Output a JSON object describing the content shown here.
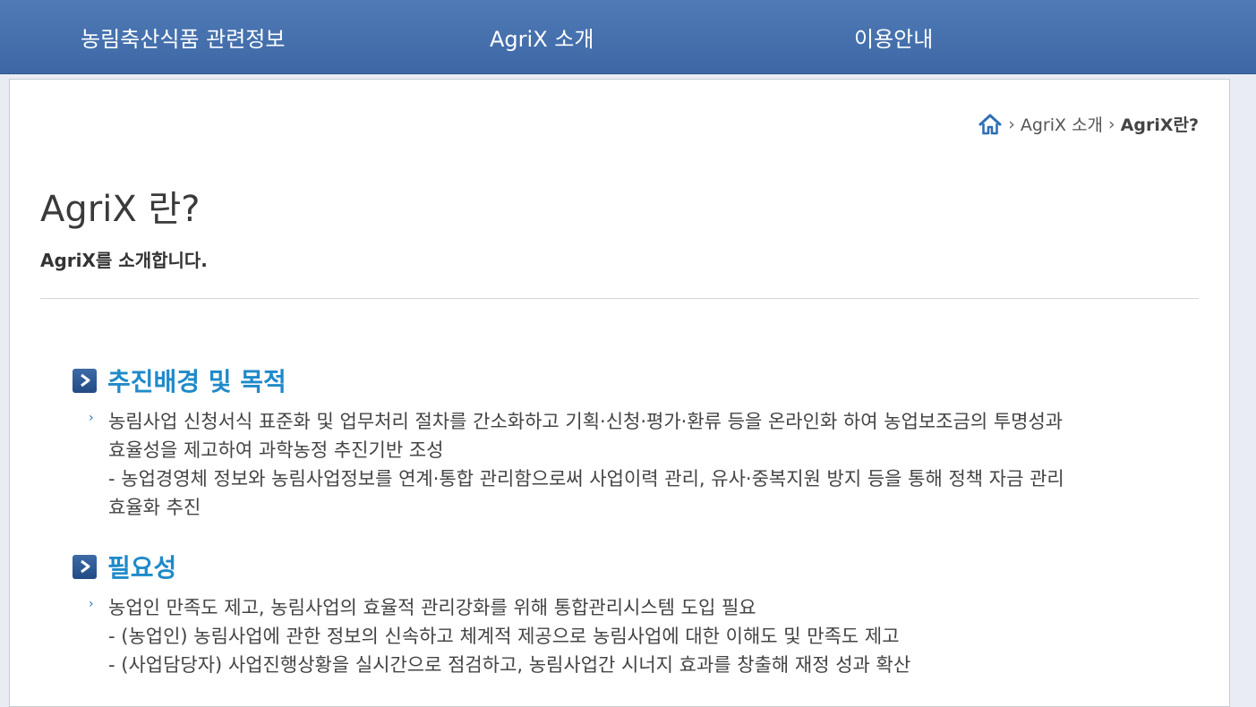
{
  "nav": {
    "items": [
      {
        "label": "농림축산식품 관련정보"
      },
      {
        "label": "AgriX 소개"
      },
      {
        "label": "이용안내"
      }
    ]
  },
  "breadcrumb": {
    "home_icon": "home-icon",
    "level1": "AgriX 소개",
    "current": "AgriX란?"
  },
  "page": {
    "title": "AgriX 란?",
    "subtitle": "AgriX를 소개합니다."
  },
  "sections": [
    {
      "title": "추진배경 및 목적",
      "lines": [
        "농림사업 신청서식 표준화 및 업무처리 절차를 간소화하고 기획·신청·평가·환류 등을 온라인화 하여 농업보조금의 투명성과",
        "효율성을 제고하여 과학농정 추진기반 조성",
        "- 농업경영체 정보와 농림사업정보를 연계·통합 관리함으로써 사업이력 관리, 유사·중복지원 방지 등을 통해 정책 자금 관리",
        "효율화 추진"
      ]
    },
    {
      "title": "필요성",
      "lines": [
        "농업인 만족도 제고, 농림사업의 효율적 관리강화를 위해 통합관리시스템 도입 필요",
        "- (농업인) 농림사업에 관한 정보의 신속하고 체계적 제공으로 농림사업에 대한 이해도 및 만족도 제고",
        "- (사업담당자) 사업진행상황을 실시간으로 점검하고, 농림사업간 시너지 효과를 창출해 재정 성과 확산"
      ]
    }
  ],
  "colors": {
    "nav_bg": "#4670ae",
    "section_title": "#1f8ac9",
    "icon_bg": "#2c5a98"
  }
}
